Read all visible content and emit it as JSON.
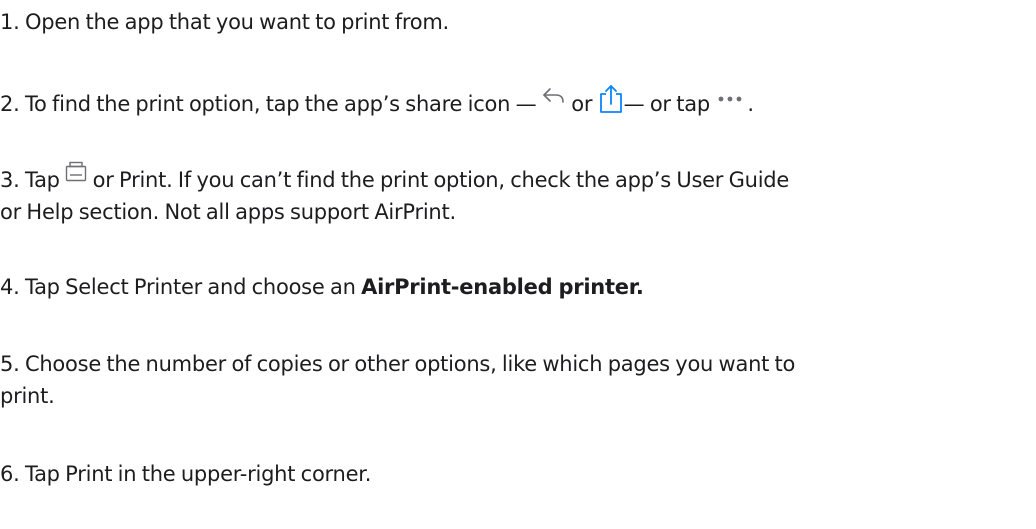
{
  "steps": {
    "s1": "1. Open the app that you want to print from.",
    "s2": {
      "prefix": "2. To find the print option, tap the app’s share icon — ",
      "or1": " or ",
      "middle": "— or tap ",
      "end": "."
    },
    "s3": {
      "prefix": "3. Tap ",
      "line1_rest": " or Print. If you can’t find the print option, check the app’s User Guide",
      "line2": "or Help section. Not all apps support AirPrint."
    },
    "s4": {
      "prefix": "4. Tap Select Printer and choose an ",
      "bold": "AirPrint-enabled printer."
    },
    "s5": {
      "line1": "5. Choose the number of copies or other options, like which pages you want to",
      "line2": "print."
    },
    "s6": "6. Tap Print in the upper-right corner."
  },
  "icons": {
    "reply_share": "reply-arrow-icon",
    "share": "share-icon",
    "more": "more-dots-icon",
    "print": "printer-icon"
  },
  "colors": {
    "text": "#1d1d1f",
    "share_accent": "#0a84ff",
    "icon_gray": "#6e6e73"
  }
}
